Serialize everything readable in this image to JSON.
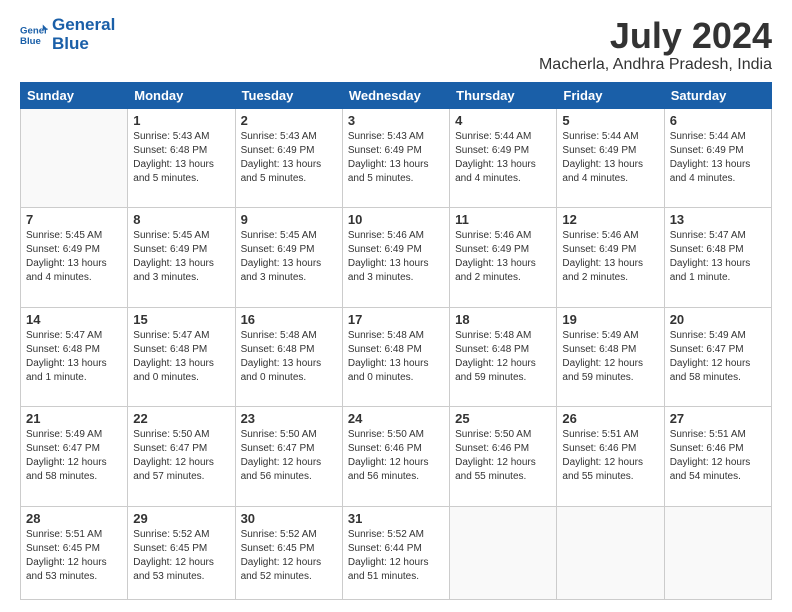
{
  "header": {
    "logo_line1": "General",
    "logo_line2": "Blue",
    "title": "July 2024",
    "subtitle": "Macherla, Andhra Pradesh, India"
  },
  "days_of_week": [
    "Sunday",
    "Monday",
    "Tuesday",
    "Wednesday",
    "Thursday",
    "Friday",
    "Saturday"
  ],
  "weeks": [
    [
      {
        "day": "",
        "info": ""
      },
      {
        "day": "1",
        "info": "Sunrise: 5:43 AM\nSunset: 6:48 PM\nDaylight: 13 hours\nand 5 minutes."
      },
      {
        "day": "2",
        "info": "Sunrise: 5:43 AM\nSunset: 6:49 PM\nDaylight: 13 hours\nand 5 minutes."
      },
      {
        "day": "3",
        "info": "Sunrise: 5:43 AM\nSunset: 6:49 PM\nDaylight: 13 hours\nand 5 minutes."
      },
      {
        "day": "4",
        "info": "Sunrise: 5:44 AM\nSunset: 6:49 PM\nDaylight: 13 hours\nand 4 minutes."
      },
      {
        "day": "5",
        "info": "Sunrise: 5:44 AM\nSunset: 6:49 PM\nDaylight: 13 hours\nand 4 minutes."
      },
      {
        "day": "6",
        "info": "Sunrise: 5:44 AM\nSunset: 6:49 PM\nDaylight: 13 hours\nand 4 minutes."
      }
    ],
    [
      {
        "day": "7",
        "info": "Sunrise: 5:45 AM\nSunset: 6:49 PM\nDaylight: 13 hours\nand 4 minutes."
      },
      {
        "day": "8",
        "info": "Sunrise: 5:45 AM\nSunset: 6:49 PM\nDaylight: 13 hours\nand 3 minutes."
      },
      {
        "day": "9",
        "info": "Sunrise: 5:45 AM\nSunset: 6:49 PM\nDaylight: 13 hours\nand 3 minutes."
      },
      {
        "day": "10",
        "info": "Sunrise: 5:46 AM\nSunset: 6:49 PM\nDaylight: 13 hours\nand 3 minutes."
      },
      {
        "day": "11",
        "info": "Sunrise: 5:46 AM\nSunset: 6:49 PM\nDaylight: 13 hours\nand 2 minutes."
      },
      {
        "day": "12",
        "info": "Sunrise: 5:46 AM\nSunset: 6:49 PM\nDaylight: 13 hours\nand 2 minutes."
      },
      {
        "day": "13",
        "info": "Sunrise: 5:47 AM\nSunset: 6:48 PM\nDaylight: 13 hours\nand 1 minute."
      }
    ],
    [
      {
        "day": "14",
        "info": "Sunrise: 5:47 AM\nSunset: 6:48 PM\nDaylight: 13 hours\nand 1 minute."
      },
      {
        "day": "15",
        "info": "Sunrise: 5:47 AM\nSunset: 6:48 PM\nDaylight: 13 hours\nand 0 minutes."
      },
      {
        "day": "16",
        "info": "Sunrise: 5:48 AM\nSunset: 6:48 PM\nDaylight: 13 hours\nand 0 minutes."
      },
      {
        "day": "17",
        "info": "Sunrise: 5:48 AM\nSunset: 6:48 PM\nDaylight: 13 hours\nand 0 minutes."
      },
      {
        "day": "18",
        "info": "Sunrise: 5:48 AM\nSunset: 6:48 PM\nDaylight: 12 hours\nand 59 minutes."
      },
      {
        "day": "19",
        "info": "Sunrise: 5:49 AM\nSunset: 6:48 PM\nDaylight: 12 hours\nand 59 minutes."
      },
      {
        "day": "20",
        "info": "Sunrise: 5:49 AM\nSunset: 6:47 PM\nDaylight: 12 hours\nand 58 minutes."
      }
    ],
    [
      {
        "day": "21",
        "info": "Sunrise: 5:49 AM\nSunset: 6:47 PM\nDaylight: 12 hours\nand 58 minutes."
      },
      {
        "day": "22",
        "info": "Sunrise: 5:50 AM\nSunset: 6:47 PM\nDaylight: 12 hours\nand 57 minutes."
      },
      {
        "day": "23",
        "info": "Sunrise: 5:50 AM\nSunset: 6:47 PM\nDaylight: 12 hours\nand 56 minutes."
      },
      {
        "day": "24",
        "info": "Sunrise: 5:50 AM\nSunset: 6:46 PM\nDaylight: 12 hours\nand 56 minutes."
      },
      {
        "day": "25",
        "info": "Sunrise: 5:50 AM\nSunset: 6:46 PM\nDaylight: 12 hours\nand 55 minutes."
      },
      {
        "day": "26",
        "info": "Sunrise: 5:51 AM\nSunset: 6:46 PM\nDaylight: 12 hours\nand 55 minutes."
      },
      {
        "day": "27",
        "info": "Sunrise: 5:51 AM\nSunset: 6:46 PM\nDaylight: 12 hours\nand 54 minutes."
      }
    ],
    [
      {
        "day": "28",
        "info": "Sunrise: 5:51 AM\nSunset: 6:45 PM\nDaylight: 12 hours\nand 53 minutes."
      },
      {
        "day": "29",
        "info": "Sunrise: 5:52 AM\nSunset: 6:45 PM\nDaylight: 12 hours\nand 53 minutes."
      },
      {
        "day": "30",
        "info": "Sunrise: 5:52 AM\nSunset: 6:45 PM\nDaylight: 12 hours\nand 52 minutes."
      },
      {
        "day": "31",
        "info": "Sunrise: 5:52 AM\nSunset: 6:44 PM\nDaylight: 12 hours\nand 51 minutes."
      },
      {
        "day": "",
        "info": ""
      },
      {
        "day": "",
        "info": ""
      },
      {
        "day": "",
        "info": ""
      }
    ]
  ]
}
